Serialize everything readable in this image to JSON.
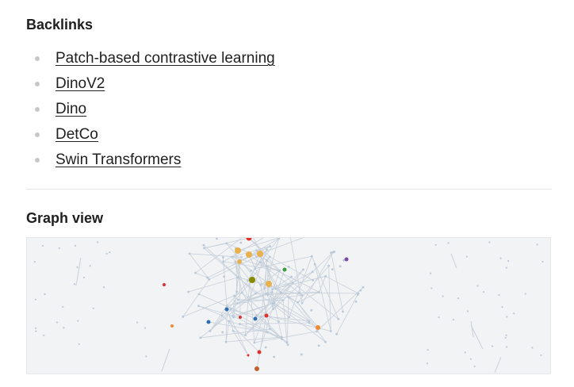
{
  "backlinks": {
    "title": "Backlinks",
    "items": [
      {
        "label": "Patch-based contrastive learning"
      },
      {
        "label": "DinoV2"
      },
      {
        "label": "Dino"
      },
      {
        "label": "DetCo"
      },
      {
        "label": "Swin Transformers"
      }
    ]
  },
  "graph": {
    "title": "Graph view",
    "colors": {
      "background": "#f2f3f5",
      "edge": "#c7d0da",
      "node": "#b9c9d8",
      "accents": [
        "#e03131",
        "#e8b14a",
        "#f08c2e",
        "#2f6fb0",
        "#3b9c3b",
        "#7a4aa8",
        "#8a8a00",
        "#c06030"
      ]
    }
  }
}
